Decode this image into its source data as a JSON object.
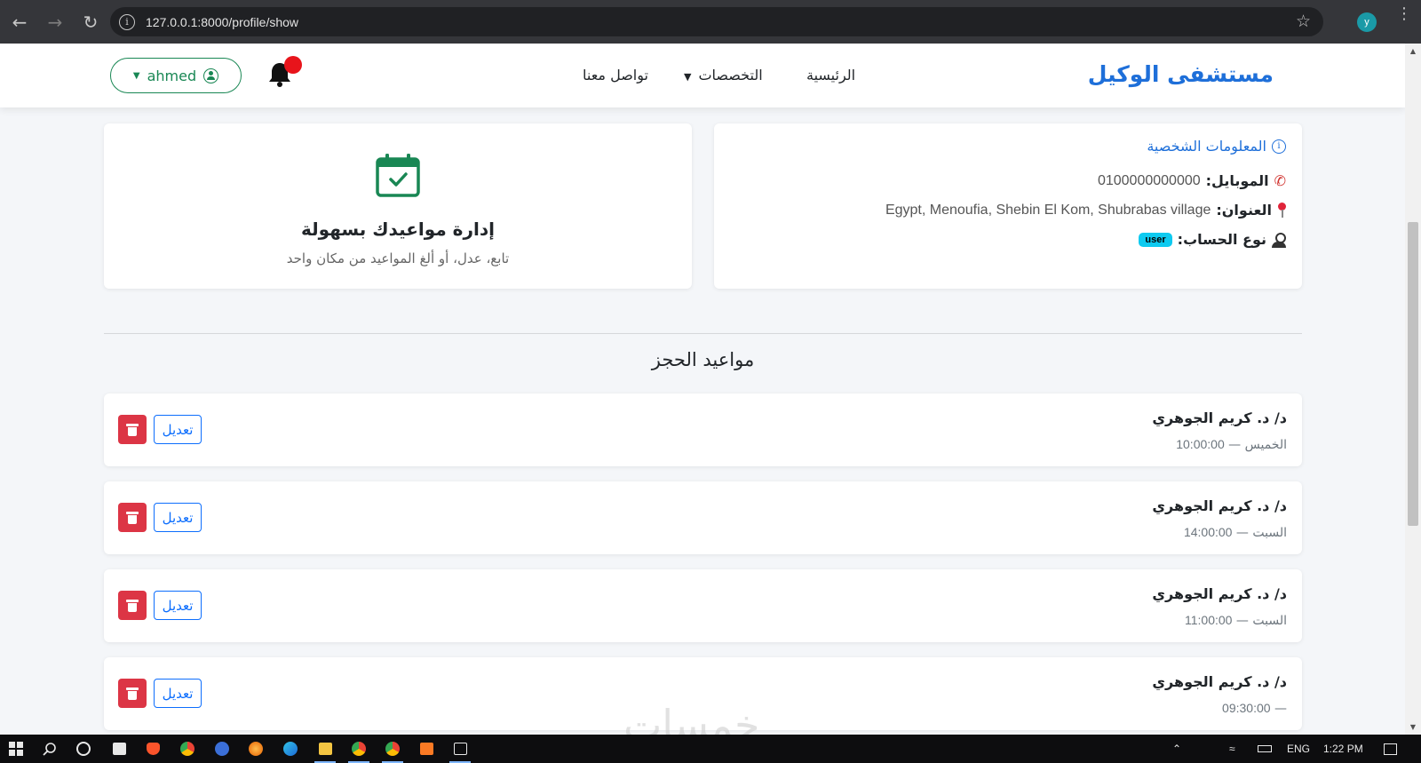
{
  "browser": {
    "url": "127.0.0.1:8000/profile/show",
    "profile_initial": "y"
  },
  "navbar": {
    "brand": "مستشفى الوكيل",
    "links": {
      "home": "الرئيسية",
      "specialties": "التخصصات",
      "contact": "تواصل معنا"
    },
    "user_name": "ahmed"
  },
  "profile": {
    "title": "المعلومات الشخصية",
    "mobile_label": "الموبايل:",
    "mobile_value": "0100000000000",
    "address_label": "العنوان:",
    "address_value": "Egypt, Menoufia, Shebin El Kom, Shubrabas village",
    "account_type_label": "نوع الحساب:",
    "account_type_value": "user"
  },
  "promo": {
    "title": "إدارة مواعيدك بسهولة",
    "subtitle": "تابع، عدل، أو ألغ المواعيد من مكان واحد"
  },
  "appointments": {
    "title": "مواعيد الحجز",
    "edit_label": "تعديل",
    "items": [
      {
        "doctor": "د/ د. كريم الجوهري",
        "day": "الخميس",
        "time": "10:00:00"
      },
      {
        "doctor": "د/ د. كريم الجوهري",
        "day": "السبت",
        "time": "14:00:00"
      },
      {
        "doctor": "د/ د. كريم الجوهري",
        "day": "السبت",
        "time": "11:00:00"
      },
      {
        "doctor": "د/ د. كريم الجوهري",
        "day": "",
        "time": "09:30:00"
      }
    ]
  },
  "watermark": "خمسات",
  "taskbar": {
    "language": "ENG",
    "time": "1:22 PM"
  },
  "colors": {
    "accent": "#1e6fd9",
    "success": "#198754",
    "danger": "#dc3545",
    "info_badge": "#0dcaf0"
  }
}
